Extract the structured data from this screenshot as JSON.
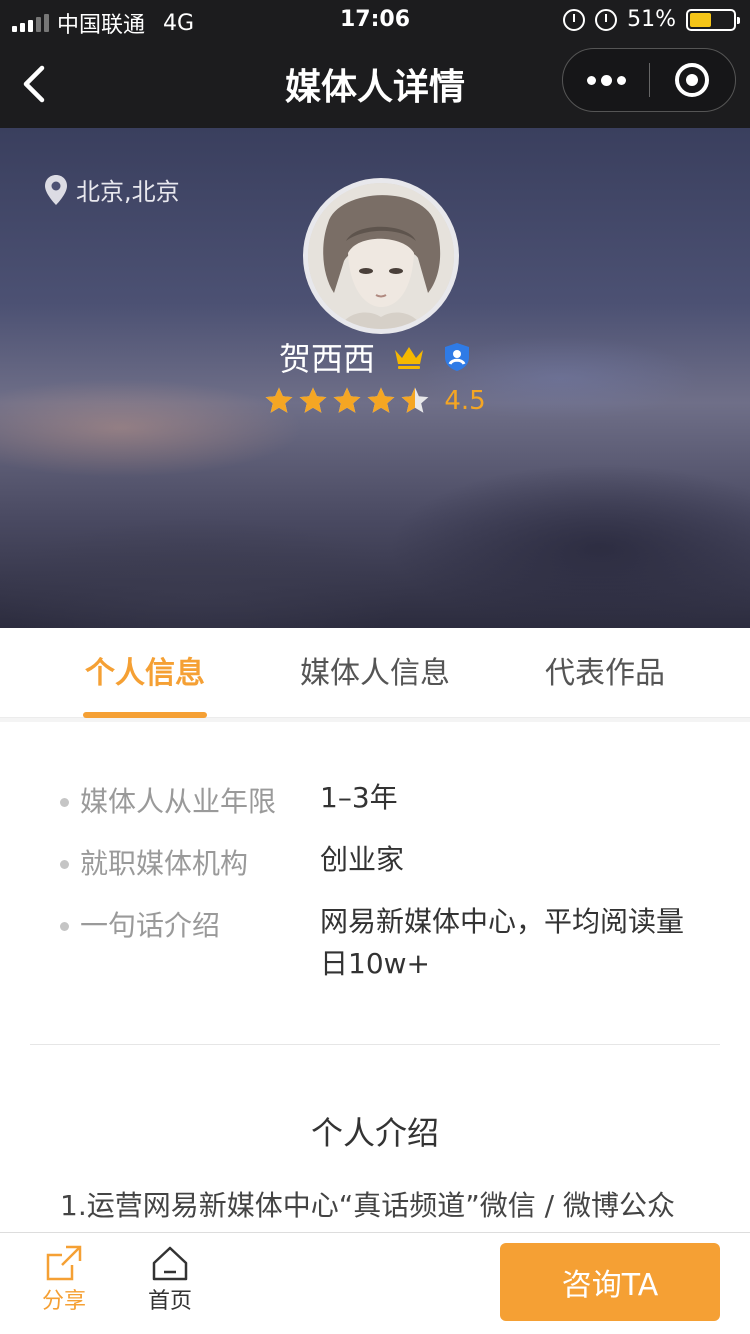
{
  "status_bar": {
    "carrier": "中国联通",
    "network": "4G",
    "time": "17:06",
    "battery": "51%",
    "battery_level": 0.51,
    "battery_color": "#f5c518"
  },
  "nav": {
    "title": "媒体人详情",
    "back_icon": "chevron-left-icon",
    "more_icon": "more-dots-icon",
    "close_icon": "target-close-icon"
  },
  "profile": {
    "location": "北京,北京",
    "name": "贺西西",
    "rating": "4.5",
    "rating_value": 4.5,
    "max_rating": 5,
    "badges": [
      "crown-icon",
      "verified-shield-icon"
    ],
    "accent_color": "#f5a623",
    "crown_color": "#f5b800",
    "verified_color": "#2f7be6"
  },
  "tabs": [
    {
      "label": "个人信息",
      "active": true
    },
    {
      "label": "媒体人信息",
      "active": false
    },
    {
      "label": "代表作品",
      "active": false
    }
  ],
  "info": [
    {
      "label": "媒体人从业年限",
      "value": "1–3年"
    },
    {
      "label": "就职媒体机构",
      "value": "创业家"
    },
    {
      "label": "一句话介绍",
      "value": "网易新媒体中心，平均阅读量日10w+"
    }
  ],
  "intro": {
    "title": "个人介绍",
    "text": "1.运营网易新媒体中心“真话频道”微信 / 微博公众"
  },
  "bottom_bar": {
    "share_label": "分享",
    "home_label": "首页",
    "consult_label": "咨询TA",
    "accent_color": "#f5a034"
  }
}
